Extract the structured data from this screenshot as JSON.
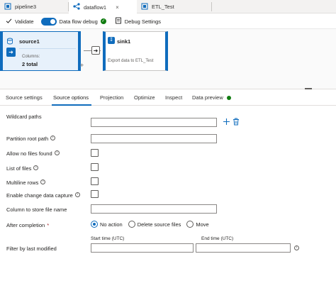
{
  "tabs": [
    {
      "label": "pipeline3",
      "icon": "pipeline-icon"
    },
    {
      "label": "dataflow1",
      "icon": "dataflow-icon"
    },
    {
      "label": "ETL_Test",
      "icon": "pipeline-icon"
    }
  ],
  "tab_close_glyph": "×",
  "toolbar": {
    "validate_label": "Validate",
    "debug_label": "Data flow debug",
    "debug_settings_label": "Debug Settings"
  },
  "canvas": {
    "source": {
      "title": "source1",
      "columns_label": "Columns:",
      "columns_value": "2 total"
    },
    "sink": {
      "title": "sink1",
      "description": "Export data to ETL_Test"
    },
    "plus_glyph": "+"
  },
  "subtabs": [
    "Source settings",
    "Source options",
    "Projection",
    "Optimize",
    "Inspect",
    "Data preview"
  ],
  "active_subtab": "Source options",
  "form": {
    "wildcard_label": "Wildcard paths",
    "wildcard_value": "",
    "partition_root_label": "Partition root path",
    "partition_root_value": "",
    "allow_no_files_label": "Allow no files found",
    "list_of_files_label": "List of files",
    "multiline_rows_label": "Multiline rows",
    "change_capture_label": "Enable change data capture",
    "column_to_store_label": "Column to store file name",
    "column_to_store_value": "",
    "after_completion_label": "After completion",
    "after_completion_options": [
      "No action",
      "Delete source files",
      "Move"
    ],
    "after_completion_selected": "No action",
    "filter_label": "Filter by last modified",
    "start_time_label": "Start time (UTC)",
    "start_time_value": "",
    "end_time_label": "End time (UTC)",
    "end_time_value": ""
  },
  "glyphs": {
    "info": "i",
    "required": "*"
  },
  "colors": {
    "accent": "#0f6cbd",
    "success": "#107c10"
  }
}
